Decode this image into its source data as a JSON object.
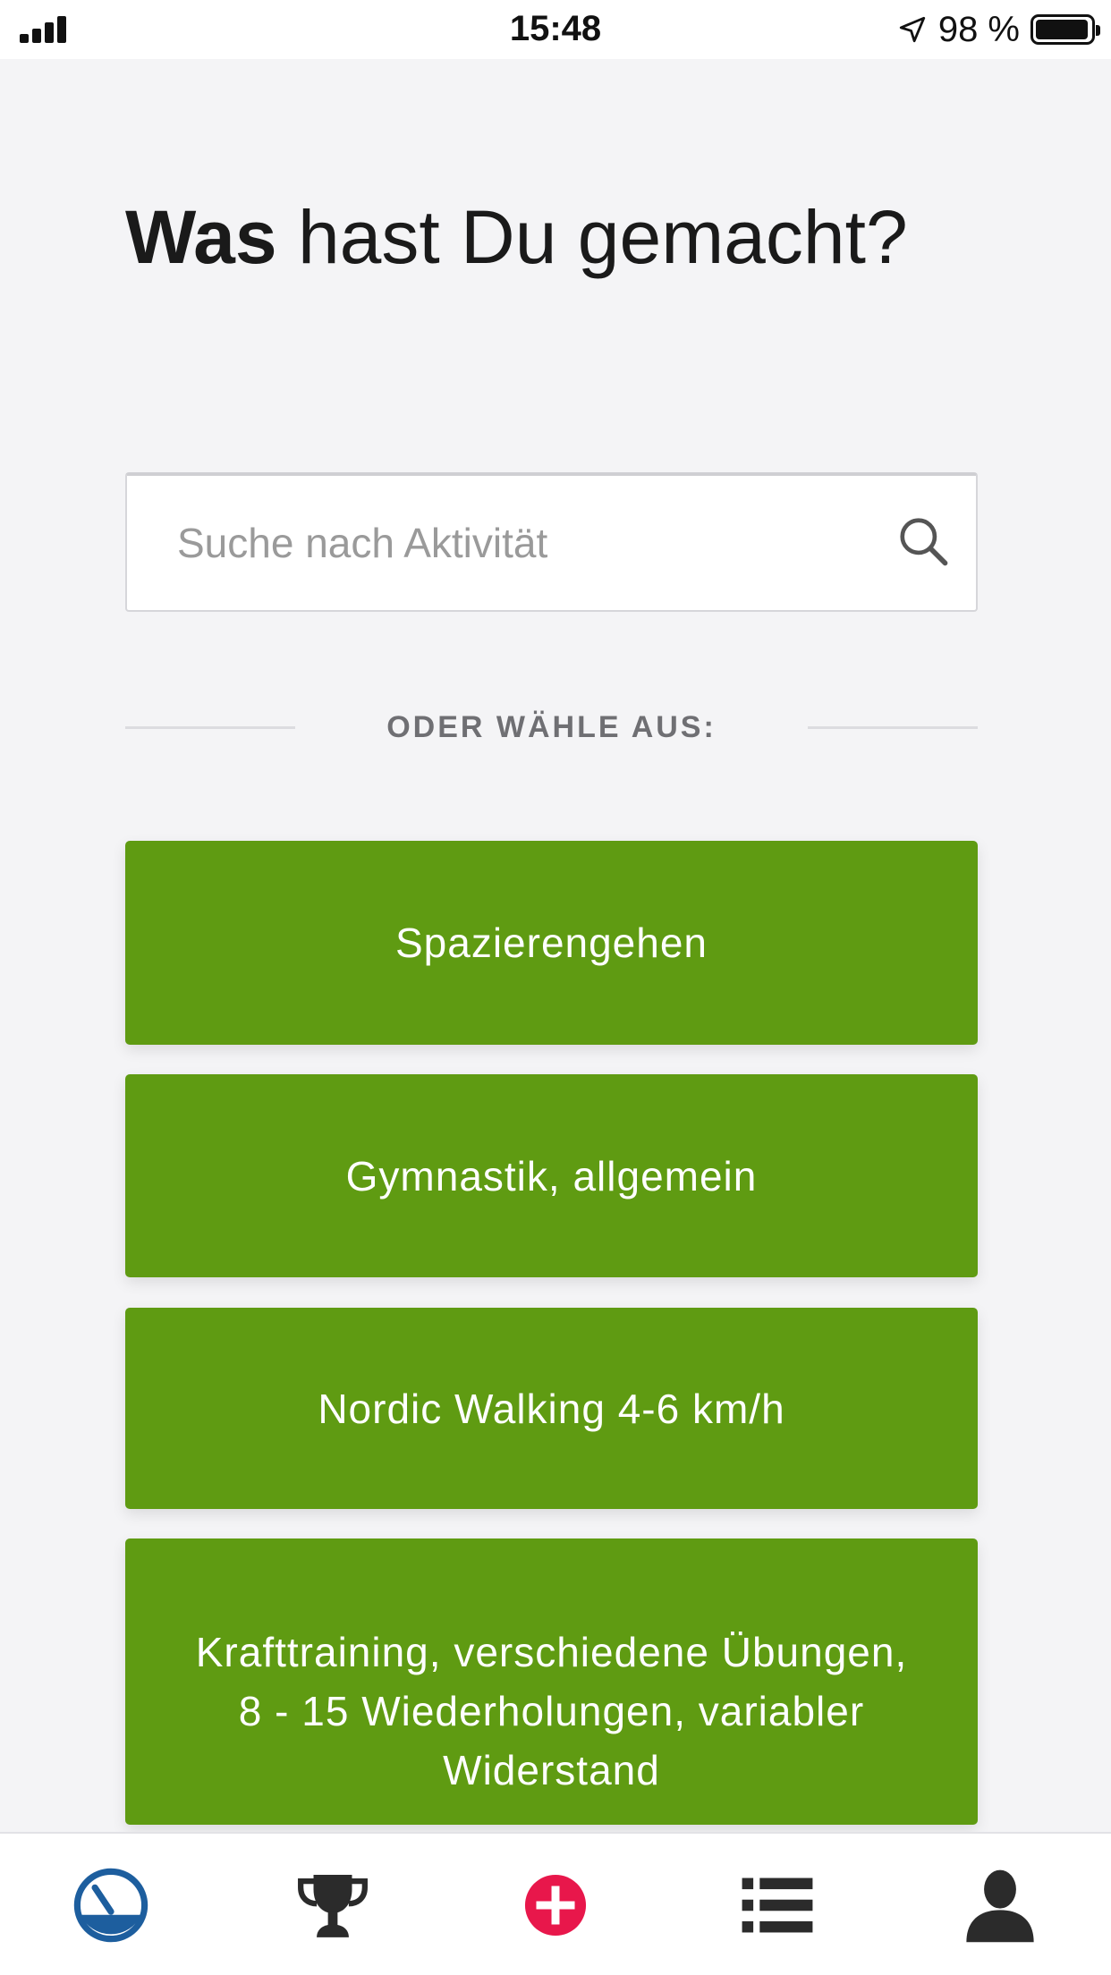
{
  "status_bar": {
    "time": "15:48",
    "battery": "98 %",
    "icons": [
      "signal-icon",
      "location-arrow-icon",
      "battery-icon"
    ]
  },
  "heading": {
    "strong": "Was",
    "rest": " hast Du gemacht?"
  },
  "search": {
    "placeholder": "Suche nach Aktivität",
    "value": ""
  },
  "divider": {
    "label": "ODER WÄHLE AUS:"
  },
  "activities": [
    {
      "label": "Spazierengehen"
    },
    {
      "label": "Gymnastik, allgemein"
    },
    {
      "label": "Nordic Walking 4-6 km/h"
    },
    {
      "label": "Krafttraining, verschiedene Übungen, 8 - 15 Wiederholungen, variabler Widerstand"
    }
  ],
  "tab_bar": {
    "tabs": [
      {
        "icon": "dashboard-gauge-icon",
        "active": true
      },
      {
        "icon": "trophy-icon",
        "active": false
      },
      {
        "icon": "add-circle-icon",
        "active": false
      },
      {
        "icon": "list-icon",
        "active": false
      },
      {
        "icon": "profile-icon",
        "active": false
      }
    ]
  },
  "colors": {
    "accent_green": "#5f9b12",
    "active_tab": "#1d5e9e",
    "add_red": "#e8174b",
    "background": "#f4f4f6"
  }
}
